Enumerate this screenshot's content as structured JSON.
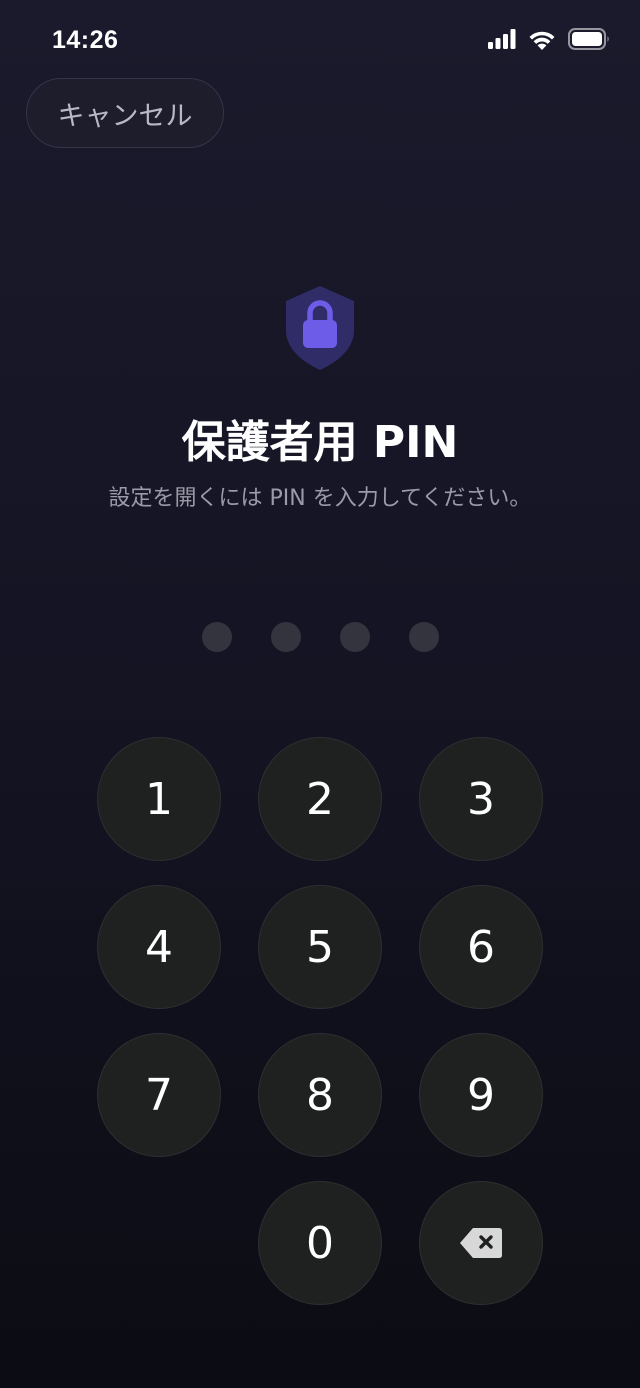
{
  "status_bar": {
    "time": "14:26",
    "icons": [
      "cellular-signal-icon",
      "wifi-icon",
      "battery-icon"
    ]
  },
  "header": {
    "cancel_label": "キャンセル"
  },
  "main": {
    "icon": "shield-lock-icon",
    "title": "保護者用 PIN",
    "subtitle": "設定を開くには PIN を入力してください。",
    "pin_length": 4,
    "pin_filled": 0
  },
  "keypad": {
    "keys": [
      "1",
      "2",
      "3",
      "4",
      "5",
      "6",
      "7",
      "8",
      "9",
      "0"
    ],
    "delete_icon": "backspace-icon"
  },
  "colors": {
    "accent": "#6c5ce7",
    "shield_bg": "#2f2c68",
    "key_bg": "#1f2020",
    "dot_empty": "#34343f"
  }
}
